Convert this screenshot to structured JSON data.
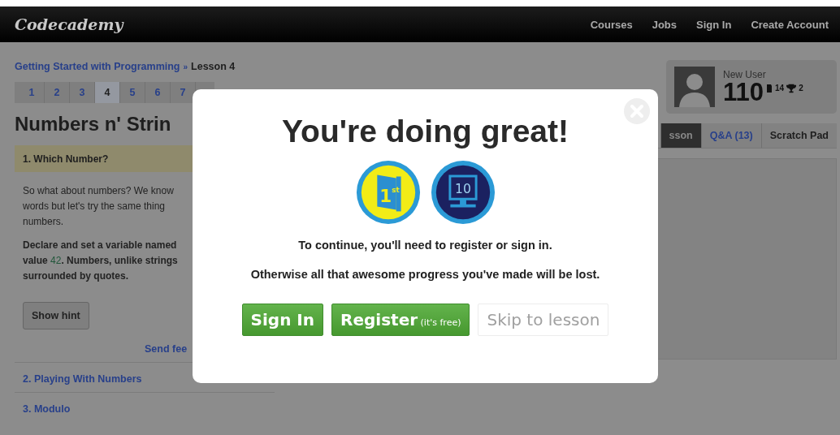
{
  "nav": {
    "logo": "Codecademy",
    "links": [
      "Courses",
      "Jobs",
      "Sign In",
      "Create Account"
    ]
  },
  "breadcrumb": {
    "course": "Getting Started with Programming",
    "separator": "»",
    "lesson": "Lesson 4"
  },
  "steps": [
    {
      "label": "1",
      "selected": false
    },
    {
      "label": "2",
      "selected": false
    },
    {
      "label": "3",
      "selected": false
    },
    {
      "label": "4",
      "selected": true
    },
    {
      "label": "5",
      "selected": false
    },
    {
      "label": "6",
      "selected": false
    },
    {
      "label": "7",
      "selected": false
    }
  ],
  "lesson_title": "Numbers n' Strin",
  "exercise": {
    "title": "1. Which Number?",
    "intro_lines": [
      "So what about numbers? We know",
      "words but let's try the same thing",
      "numbers."
    ],
    "instruction_lines": [
      {
        "text": "Declare and set a variable named"
      },
      {
        "text": "value ",
        "code": "42",
        "after": ". Numbers, unlike strings"
      },
      {
        "text": "surrounded by quotes."
      }
    ],
    "hint_button": "Show hint",
    "feedback_link": "Send fee"
  },
  "exercises": [
    "2. Playing With Numbers",
    "3. Modulo"
  ],
  "user": {
    "name": "New User",
    "points": "110",
    "badges": "14",
    "trophies": "2"
  },
  "tabs": [
    {
      "label": "sson",
      "selected": true
    },
    {
      "label": "Q&A (13)",
      "selected": false
    },
    {
      "label": "Scratch Pad",
      "selected": false
    }
  ],
  "modal": {
    "title": "You're doing great!",
    "badges": [
      {
        "kind": "book",
        "label": "1",
        "sup": "st"
      },
      {
        "kind": "monitor",
        "label": "10"
      }
    ],
    "message": "To continue, you'll need to register or sign in.",
    "warning": "Otherwise all that awesome progress you've made will be lost.",
    "buttons": [
      {
        "kind": "primary",
        "label": "Sign In"
      },
      {
        "kind": "primary",
        "label": "Register",
        "note": "(it's free)"
      },
      {
        "kind": "muted",
        "label": "Skip to lesson"
      }
    ]
  }
}
